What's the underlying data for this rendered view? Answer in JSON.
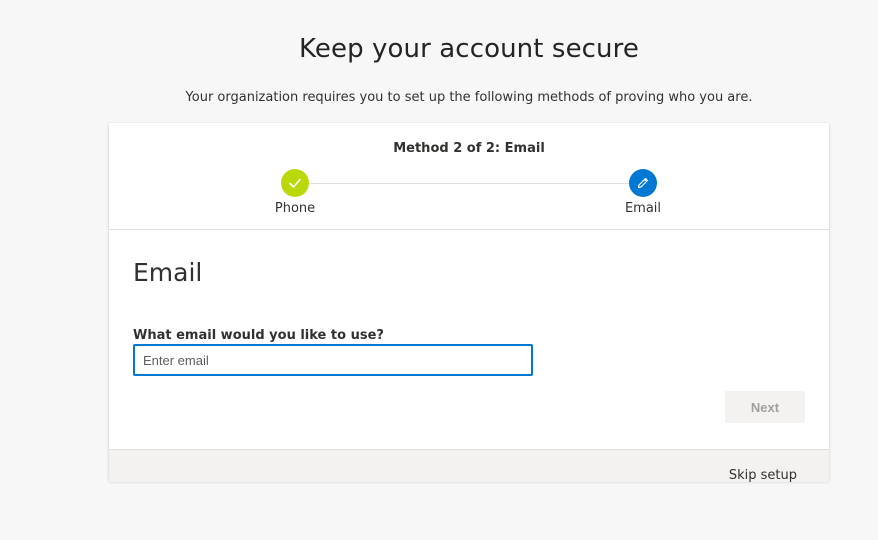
{
  "header": {
    "title": "Keep your account secure",
    "subtitle": "Your organization requires you to set up the following methods of proving who you are."
  },
  "stepper": {
    "method_label": "Method 2 of 2: Email",
    "steps": [
      {
        "label": "Phone",
        "status": "complete",
        "icon": "checkmark-icon",
        "color": "#bad80a"
      },
      {
        "label": "Email",
        "status": "current",
        "icon": "pencil-icon",
        "color": "#0078d4"
      }
    ]
  },
  "form": {
    "section_title": "Email",
    "field_label": "What email would you like to use?",
    "email_value": "",
    "email_placeholder": "Enter email",
    "next_label": "Next"
  },
  "footer": {
    "skip_label": "Skip setup"
  },
  "colors": {
    "accent": "#0078d4",
    "complete": "#bad80a",
    "page_background": "#f7f7f7"
  }
}
